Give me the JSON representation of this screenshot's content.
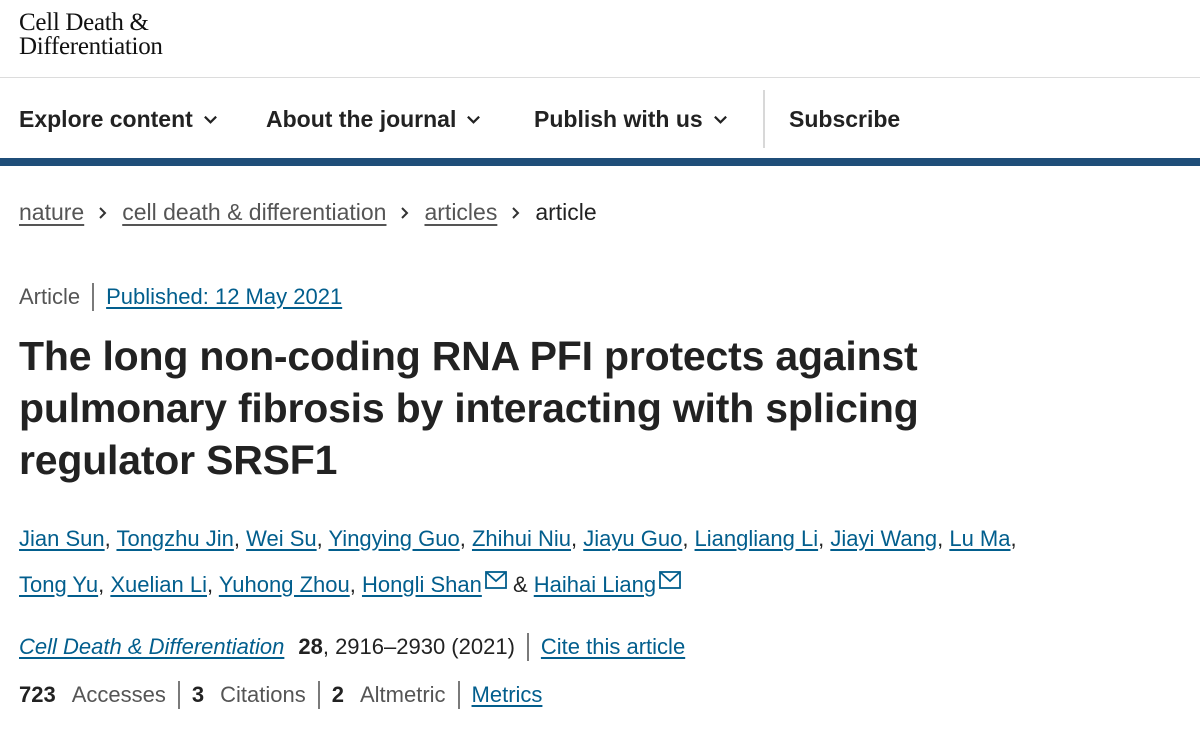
{
  "logo": {
    "line1": "Cell Death &",
    "line2": "Differentiation"
  },
  "nav": {
    "explore": "Explore content",
    "about": "About the journal",
    "publish": "Publish with us",
    "subscribe": "Subscribe"
  },
  "breadcrumb": {
    "items": [
      "nature",
      "cell death & differentiation",
      "articles"
    ],
    "current": "article"
  },
  "article": {
    "type": "Article",
    "published": "Published: 12 May 2021",
    "title": "The long non-coding RNA PFI protects against pulmonary fibrosis by interacting with splicing regulator SRSF1",
    "authors": [
      "Jian Sun",
      "Tongzhu Jin",
      "Wei Su",
      "Yingying Guo",
      "Zhihui Niu",
      "Jiayu Guo",
      "Liangliang Li",
      "Jiayi Wang",
      "Lu Ma",
      "Tong Yu",
      "Xuelian Li",
      "Yuhong Zhou",
      "Hongli Shan",
      "Haihai Liang"
    ],
    "author_separator": ",",
    "author_last_joiner": "&"
  },
  "citation": {
    "journal": "Cell Death & Differentiation",
    "volume": "28",
    "pages_year": ", 2916–2930 (2021)",
    "cite_link": "Cite this article"
  },
  "metrics": {
    "accesses_count": "723",
    "accesses_label": "Accesses",
    "citations_count": "3",
    "citations_label": "Citations",
    "altmetric_count": "2",
    "altmetric_label": "Altmetric",
    "metrics_link": "Metrics"
  },
  "colors": {
    "link": "#025e8d",
    "nav_underline": "#1f4e79",
    "text": "#222222",
    "muted": "#555555"
  },
  "icons": {
    "chevron": "chevron-down-icon",
    "breadcrumb_sep": "chevron-right-icon",
    "email": "mail-icon"
  }
}
